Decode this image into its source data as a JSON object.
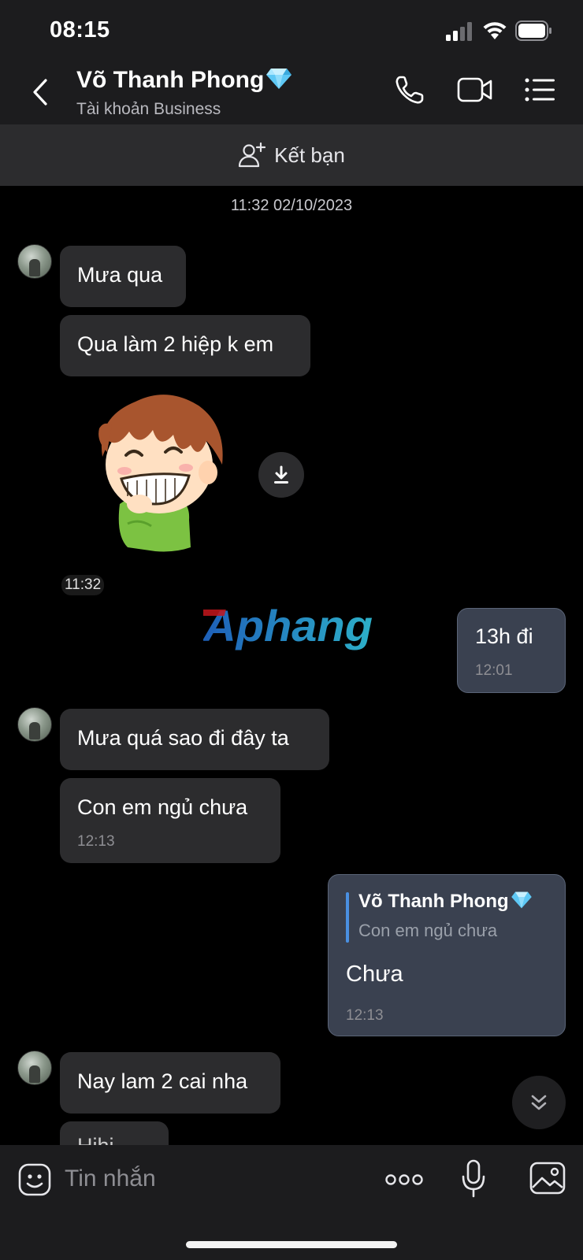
{
  "status": {
    "time": "08:15"
  },
  "header": {
    "contact_name": "Võ Thanh Phong",
    "account_type": "Tài khoản Business"
  },
  "friend_bar": {
    "label": "Kết bạn"
  },
  "chat": {
    "date_divider": "11:32 02/10/2023",
    "messages": [
      {
        "sender": "contact",
        "text": "Mưa qua"
      },
      {
        "sender": "contact",
        "text": "Qua làm 2 hiệp k em"
      },
      {
        "sender": "contact",
        "type": "sticker",
        "time": "11:32"
      },
      {
        "sender": "me",
        "text": "13h đi",
        "time": "12:01"
      },
      {
        "sender": "contact",
        "text": "Mưa quá sao đi đây ta"
      },
      {
        "sender": "contact",
        "text": "Con em ngủ chưa",
        "time": "12:13"
      },
      {
        "sender": "me",
        "reply_to_name": "Võ Thanh Phong",
        "reply_to_text": "Con em ngủ chưa",
        "text": "Chưa",
        "time": "12:13"
      },
      {
        "sender": "contact",
        "text": "Nay lam 2 cai nha"
      },
      {
        "sender": "contact",
        "text": "Hihi",
        "partial": true
      }
    ]
  },
  "watermark": {
    "text": "Aphang"
  },
  "input": {
    "placeholder": "Tin nhắn"
  },
  "colors": {
    "my_bubble": "#3a4150",
    "their_bubble": "#2c2c2e",
    "quote_accent": "#4a90e2"
  }
}
